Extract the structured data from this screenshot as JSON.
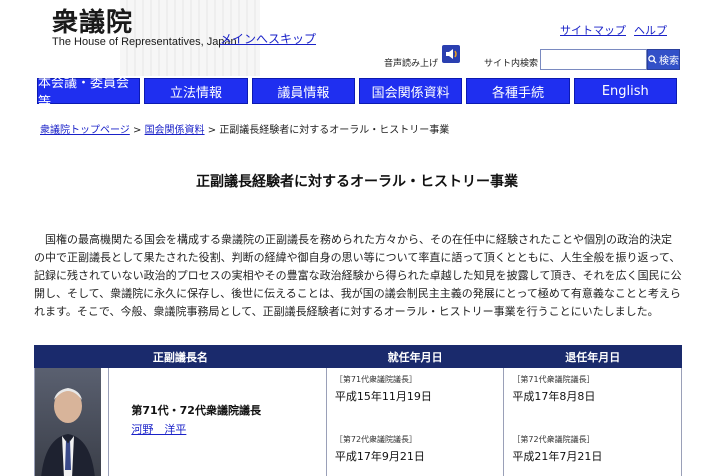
{
  "header": {
    "logo_jp": "衆議院",
    "logo_en": "The House of Representatives, Japan",
    "skip_link": "メインへスキップ",
    "sitemap": "サイトマップ",
    "help": "ヘルプ",
    "tts_label": "音声読み上げ",
    "search_label": "サイト内検索",
    "search_value": "",
    "search_button": "検索"
  },
  "nav": [
    {
      "label": "本会議・委員会等"
    },
    {
      "label": "立法情報"
    },
    {
      "label": "議員情報"
    },
    {
      "label": "国会関係資料"
    },
    {
      "label": "各種手続"
    },
    {
      "label": "English"
    }
  ],
  "breadcrumb": {
    "home": "衆議院トップページ",
    "sep": " > ",
    "parent": "国会関係資料",
    "current": "正副議長経験者に対するオーラル・ヒストリー事業"
  },
  "page_title": "正副議長経験者に対するオーラル・ヒストリー事業",
  "intro": "国権の最高機関たる国会を構成する衆議院の正副議長を務められた方々から、その在任中に経験されたことや個別の政治的決定の中で正副議長として果たされた役割、判断の経緯や御自身の思い等について率直に語って頂くとともに、人生全般を振り返って、記録に残されていない政治的プロセスの実相やその豊富な政治経験から得られた卓越した知見を披露して頂き、それを広く国民に公開し、そして、衆議院に永久に保存し、後世に伝えることは、我が国の議会制民主主義の発展にとって極めて有意義なことと考えられます。そこで、今般、衆議院事務局として、正副議長経験者に対するオーラル・ヒストリー事業を行うことにいたしました。",
  "table": {
    "headers": {
      "name": "正副議長名",
      "start": "就任年月日",
      "end": "退任年月日"
    },
    "rows": [
      {
        "rank": "第71代・72代衆議院議長",
        "name": "河野　洋平",
        "start": [
          {
            "session": "［第71代衆議院議長］",
            "date": "平成15年11月19日"
          },
          {
            "session": "［第72代衆議院議長］",
            "date": "平成17年9月21日"
          }
        ],
        "end": [
          {
            "session": "［第71代衆議院議長］",
            "date": "平成17年8月8日"
          },
          {
            "session": "［第72代衆議院議長］",
            "date": "平成21年7月21日"
          }
        ]
      }
    ]
  }
}
